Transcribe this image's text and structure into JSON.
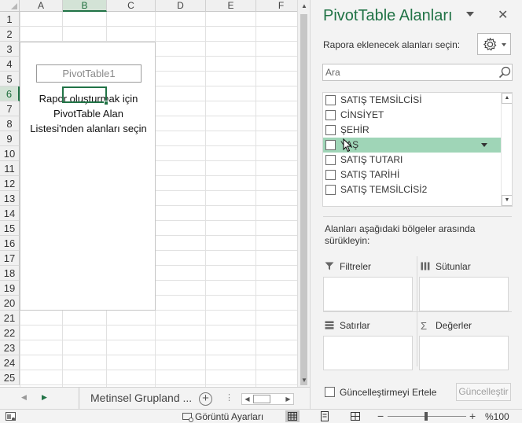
{
  "grid": {
    "columns": [
      "A",
      "B",
      "C",
      "D",
      "E",
      "F"
    ],
    "selected_column": "B",
    "rows": [
      "1",
      "2",
      "3",
      "4",
      "5",
      "6",
      "7",
      "8",
      "9",
      "10",
      "11",
      "12",
      "13",
      "14",
      "15",
      "16",
      "17",
      "18",
      "19",
      "20",
      "21",
      "22",
      "23",
      "24",
      "25"
    ],
    "selected_row": "6"
  },
  "pivot_placeholder": {
    "name": "PivotTable1",
    "line1": "Rapor oluşturmak için",
    "line2": "PivotTable Alan",
    "line3": "Listesi'nden alanları seçin"
  },
  "sheet_tabs": {
    "active_sheet": "Metinsel Grupland ...",
    "add_symbol": "+",
    "overflow_symbol": "⋮"
  },
  "pane": {
    "title": "PivotTable Alanları",
    "choose_fields_label": "Rapora eklenecek alanları seçin:",
    "search_placeholder": "Ara",
    "fields": [
      {
        "label": "SATIŞ TEMSİLCİSİ",
        "checked": false,
        "highlighted": false
      },
      {
        "label": "CİNSİYET",
        "checked": false,
        "highlighted": false
      },
      {
        "label": "ŞEHİR",
        "checked": false,
        "highlighted": false
      },
      {
        "label": "YAŞ",
        "checked": false,
        "highlighted": true
      },
      {
        "label": "SATIŞ TUTARI",
        "checked": false,
        "highlighted": false
      },
      {
        "label": "SATIŞ TARİHİ",
        "checked": false,
        "highlighted": false
      },
      {
        "label": "SATIŞ TEMSİLCİSİ2",
        "checked": false,
        "highlighted": false
      }
    ],
    "drag_instruction": "Alanları aşağıdaki bölgeler arasında sürükleyin:",
    "areas": {
      "filters": "Filtreler",
      "columns": "Sütunlar",
      "rows": "Satırlar",
      "values": "Değerler"
    },
    "defer_update_label": "Güncelleştirmeyi Ertele",
    "update_button": "Güncelleştir"
  },
  "status_bar": {
    "display_settings": "Görüntü Ayarları",
    "zoom_minus": "−",
    "zoom_plus": "+",
    "zoom_level": "%100"
  },
  "colors": {
    "accent": "#217346",
    "highlight": "#9fd5b7"
  }
}
